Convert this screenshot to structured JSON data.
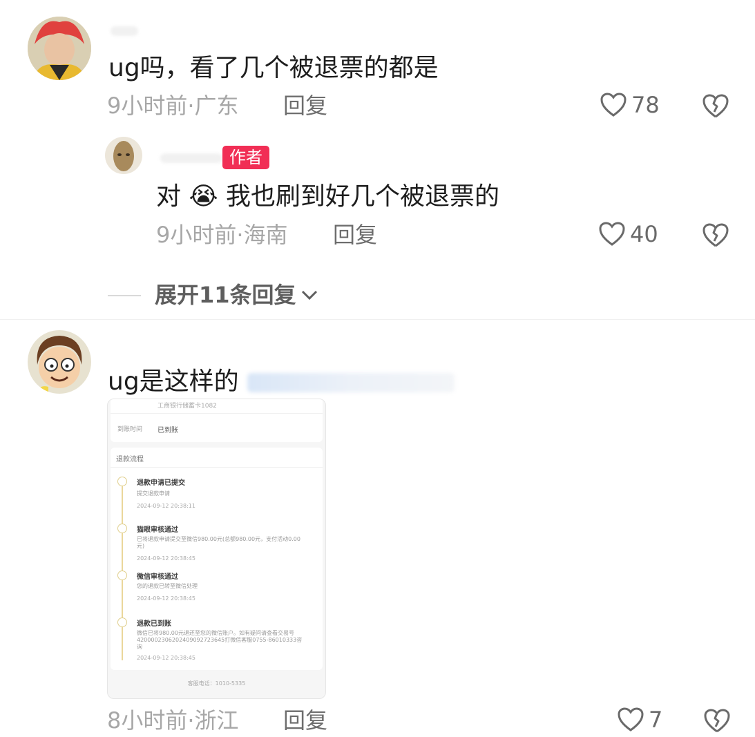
{
  "comments": [
    {
      "text": "ug吗，看了几个被退票的都是",
      "time_location": "9小时前·广东",
      "reply_label": "回复",
      "likes": "78",
      "avatar_icon": "red-hair-character-avatar"
    },
    {
      "badge": "作者",
      "text_before": "对",
      "emoji": "😭",
      "text_after": "我也刷到好几个被退票的",
      "time_location": "9小时前·海南",
      "reply_label": "回复",
      "likes": "40",
      "avatar_icon": "figure-avatar"
    },
    {
      "text": "ug是这样的",
      "time_location": "8小时前·浙江",
      "reply_label": "回复",
      "likes": "7",
      "avatar_icon": "cartoon-boy-avatar"
    }
  ],
  "expand_replies": "展开11条回复",
  "attachment": {
    "row_top": "工商银行储蓄卡1082",
    "arrival_label": "到账时间",
    "arrival_value": "已到账",
    "section_title": "退款流程",
    "steps": [
      {
        "title": "退款申请已提交",
        "desc": "提交退款申请",
        "time": "2024-09-12 20:38:11"
      },
      {
        "title": "猫眼审核通过",
        "desc": "已将退款申请提交至微信980.00元(总额980.00元，支付活动0.00元)",
        "time": "2024-09-12 20:38:45"
      },
      {
        "title": "微信审核通过",
        "desc": "您的退款已转至微信处理",
        "time": "2024-09-12 20:38:45"
      },
      {
        "title": "退款已到账",
        "desc": "微信已将980.00元退还至您的微信账户。如有疑问请查看交易号4200002306202409092723645打微信客服0755-86010333咨询",
        "time": "2024-09-12 20:38:45"
      }
    ],
    "footer": "客服电话：1010-5335"
  },
  "colors": {
    "badge": "#f12e55",
    "meta": "#a7a7a7",
    "text": "#1d1d1d"
  }
}
